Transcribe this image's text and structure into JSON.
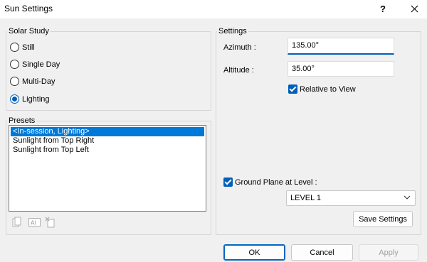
{
  "window": {
    "title": "Sun Settings",
    "help_label": "?",
    "close_label": "✕"
  },
  "solar_study": {
    "legend": "Solar Study",
    "options": [
      {
        "label": "Still",
        "checked": false
      },
      {
        "label": "Single Day",
        "checked": false
      },
      {
        "label": "Multi-Day",
        "checked": false
      },
      {
        "label": "Lighting",
        "checked": true
      }
    ]
  },
  "presets": {
    "legend": "Presets",
    "items": [
      {
        "label": "<In-session, Lighting>",
        "selected": true
      },
      {
        "label": "Sunlight from Top Right",
        "selected": false
      },
      {
        "label": "Sunlight from Top Left",
        "selected": false
      }
    ],
    "tools": [
      "duplicate-icon",
      "rename-icon",
      "delete-icon"
    ]
  },
  "settings": {
    "legend": "Settings",
    "azimuth_label": "Azimuth :",
    "azimuth_value": "135.00°",
    "altitude_label": "Altitude :",
    "altitude_value": "35.00°",
    "relative_label": "Relative to View",
    "relative_checked": true,
    "ground_plane_label": "Ground Plane at Level :",
    "ground_plane_checked": true,
    "level_value": "LEVEL 1",
    "save_label": "Save Settings"
  },
  "footer": {
    "ok_label": "OK",
    "cancel_label": "Cancel",
    "apply_label": "Apply"
  },
  "colors": {
    "accent": "#005fb8",
    "selection": "#0078d7",
    "background": "#f0f0f0"
  }
}
